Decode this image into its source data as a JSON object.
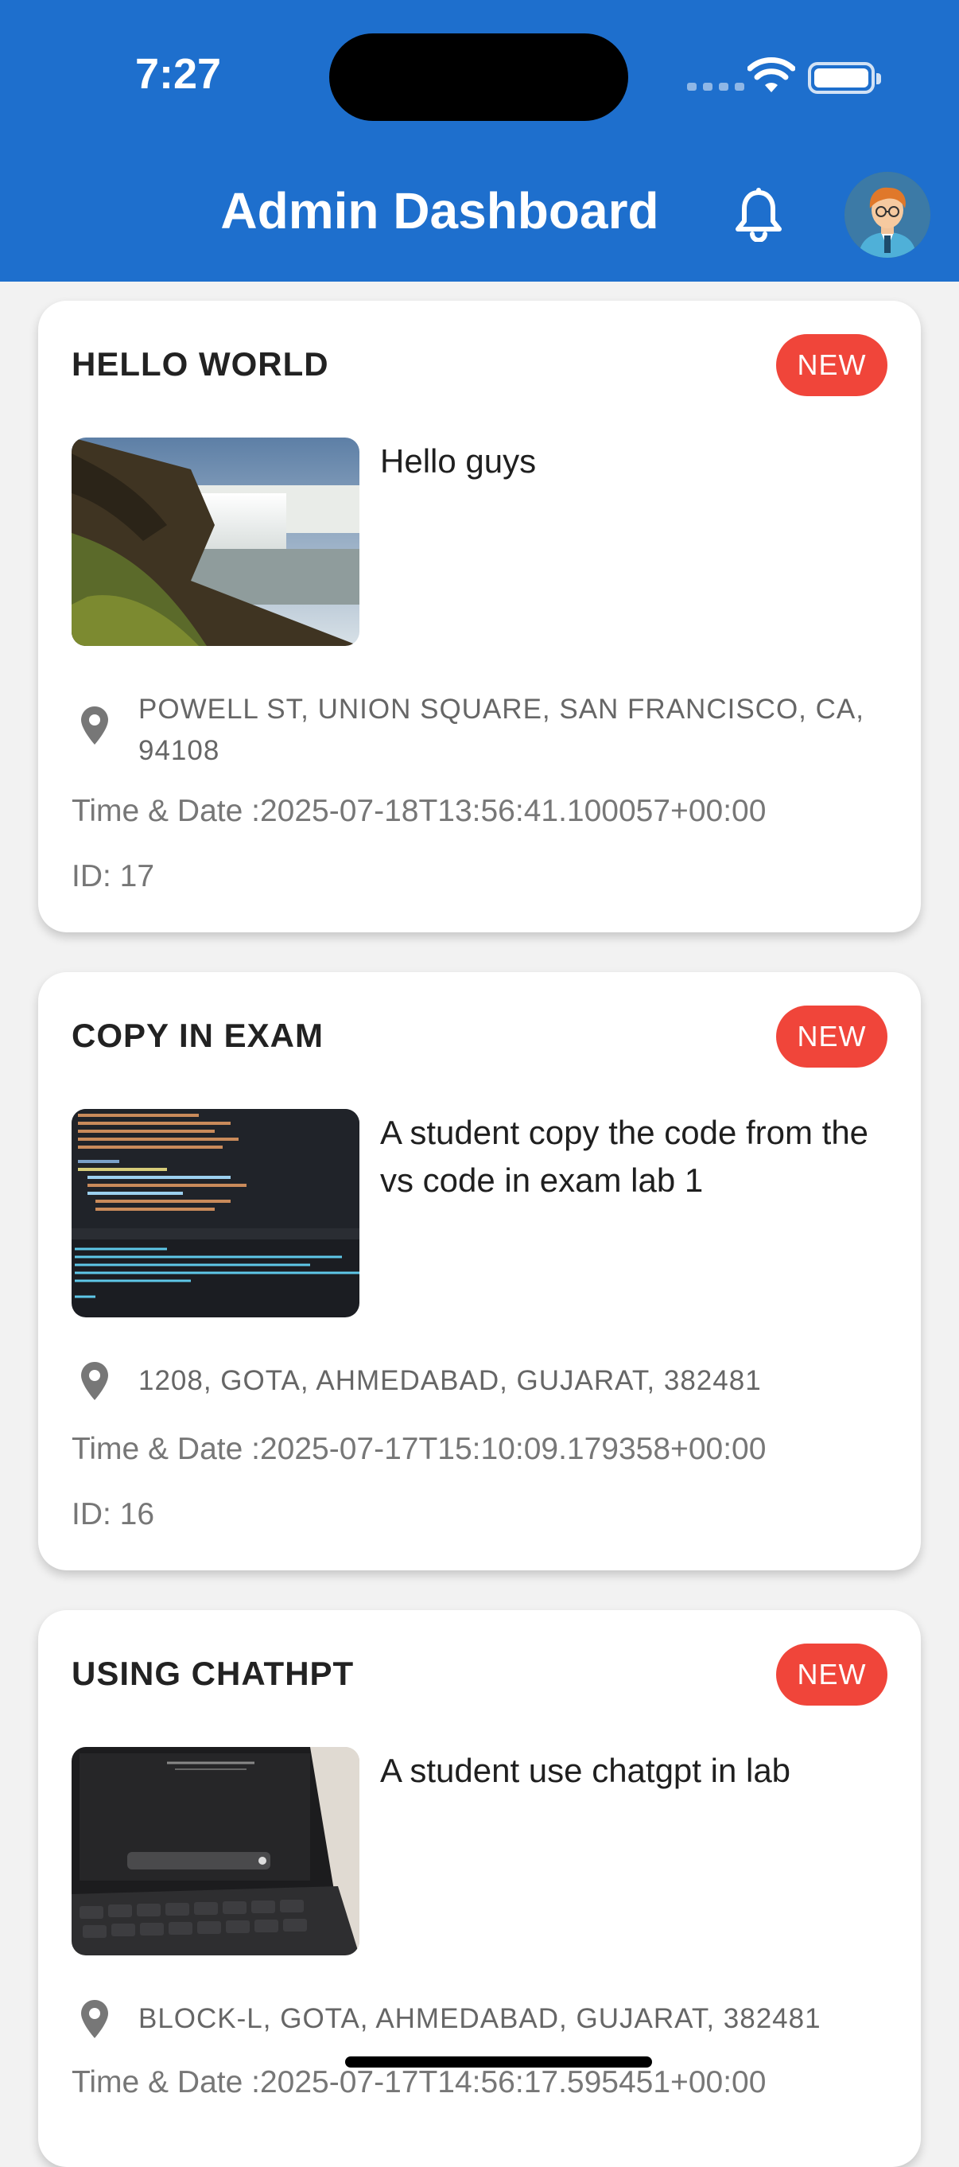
{
  "status_bar": {
    "time": "7:27"
  },
  "header": {
    "title": "Admin Dashboard"
  },
  "icons": {
    "notifications": "bell-icon",
    "profile": "avatar",
    "location": "location-pin-icon"
  },
  "colors": {
    "header": "#1e6fcd",
    "badge": "#f0453a",
    "background": "#f2f2f2"
  },
  "reports": [
    {
      "title": "HELLO WORLD",
      "badge": "NEW",
      "description": "Hello guys",
      "address": "POWELL ST, UNION SQUARE, SAN FRANCISCO, CA, 94108",
      "datetime": "Time & Date :2025-07-18T13:56:41.100057+00:00",
      "id": "ID: 17"
    },
    {
      "title": "COPY IN EXAM",
      "badge": "NEW",
      "description": "A student copy the code from the vs code in exam lab 1",
      "address": "1208, GOTA, AHMEDABAD, GUJARAT, 382481",
      "datetime": "Time & Date :2025-07-17T15:10:09.179358+00:00",
      "id": "ID: 16"
    },
    {
      "title": "USING CHATHPT",
      "badge": "NEW",
      "description": "A student use chatgpt in lab",
      "address": "BLOCK-L, GOTA, AHMEDABAD, GUJARAT, 382481",
      "datetime": "Time & Date :2025-07-17T14:56:17.595451+00:00"
    }
  ]
}
